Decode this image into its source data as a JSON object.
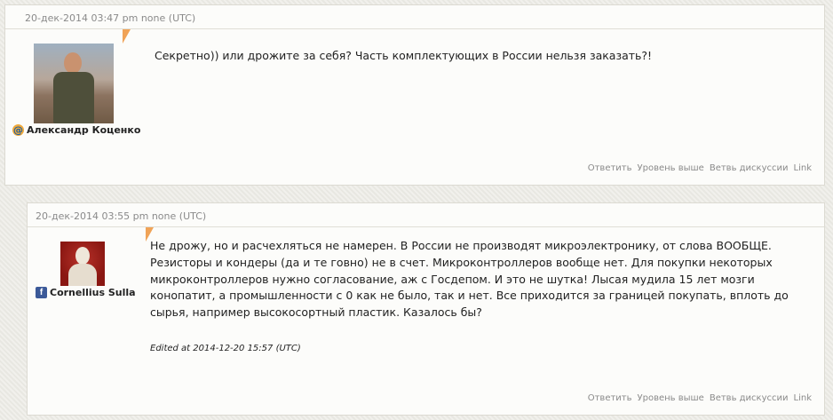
{
  "comments": [
    {
      "meta": "20-дек-2014 03:47 pm none (UTC)",
      "author": "Александр Коценко",
      "author_icon": "livejournal-at-icon",
      "text": "Секретно)) или дрожите за себя? Часть комплектующих в России нельзя заказать?!",
      "actions": [
        "Ответить",
        "Уровень выше",
        "Ветвь дискуссии",
        "Link"
      ]
    },
    {
      "meta": "20-дек-2014 03:55 pm none (UTC)",
      "author": "Cornellius Sulla",
      "author_icon": "facebook-icon",
      "text_lines": [
        "Не дрожу, но и расчехляться не намерен. В России не производят микроэлектронику, от слова ВООБЩЕ.",
        "Резисторы и кондеры (да и те говно) не в счет. Микроконтроллеров вообще нет. Для покупки некоторых",
        "микроконтроллеров нужно согласование, аж с Госдепом. И это не шутка! Лысая мудила 15 лет мозги",
        "конопатит, а промышленности с 0 как не было, так и нет. Все приходится за границей покупать, вплоть до",
        "сырья, например высокосортный пластик. Казалось бы?"
      ],
      "edited": "Edited at 2014-12-20 15:57 (UTC)",
      "actions": [
        "Ответить",
        "Уровень выше",
        "Ветвь дискуссии",
        "Link"
      ]
    }
  ],
  "colors": {
    "flag": "#f0a357",
    "facebook": "#3b5998",
    "background": "#ecebe5"
  }
}
